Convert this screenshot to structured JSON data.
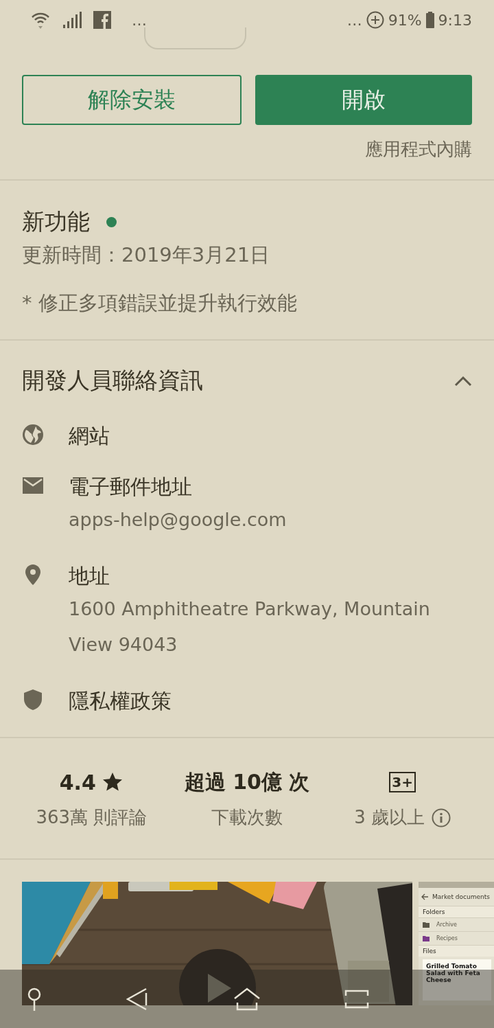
{
  "status_bar": {
    "left_more": "…",
    "right_more": "…",
    "battery": "91%",
    "time": "9:13"
  },
  "actions": {
    "buttons": [
      {
        "label": "解除安裝",
        "kind": "outlined"
      },
      {
        "label": "開啟",
        "kind": "filled"
      }
    ],
    "note": "應用程式內購"
  },
  "whats_new": {
    "title": "新功能",
    "updated": "更新時間：2019年3月21日",
    "notes": "* 修正多項錯誤並提升執行效能"
  },
  "developer": {
    "title": "開發人員聯絡資訊",
    "expanded": true,
    "items": [
      {
        "kind": "website",
        "label": "網站"
      },
      {
        "kind": "email",
        "label": "電子郵件地址",
        "detail": "apps-help@google.com"
      },
      {
        "kind": "address",
        "label": "地址",
        "detail": "1600 Amphitheatre Parkway, Mountain View 94043"
      },
      {
        "kind": "privacy",
        "label": "隱私權政策"
      }
    ]
  },
  "stats": [
    {
      "kind": "rating",
      "value": "4.4",
      "caption": "363萬 則評論"
    },
    {
      "kind": "downloads",
      "value": "超過 10億 次",
      "caption": "下載次數"
    },
    {
      "kind": "content_rating",
      "badge": "3+",
      "caption": "3 歲以上"
    }
  ],
  "screenshots": [
    {
      "kind": "picture"
    },
    {
      "kind": "app_screen",
      "title": "Market documents",
      "folders_label": "Folders",
      "folders": [
        "Archive",
        "Recipes"
      ],
      "files_label": "Files",
      "file": "Grilled Tomato Salad with Feta Cheese"
    }
  ]
}
